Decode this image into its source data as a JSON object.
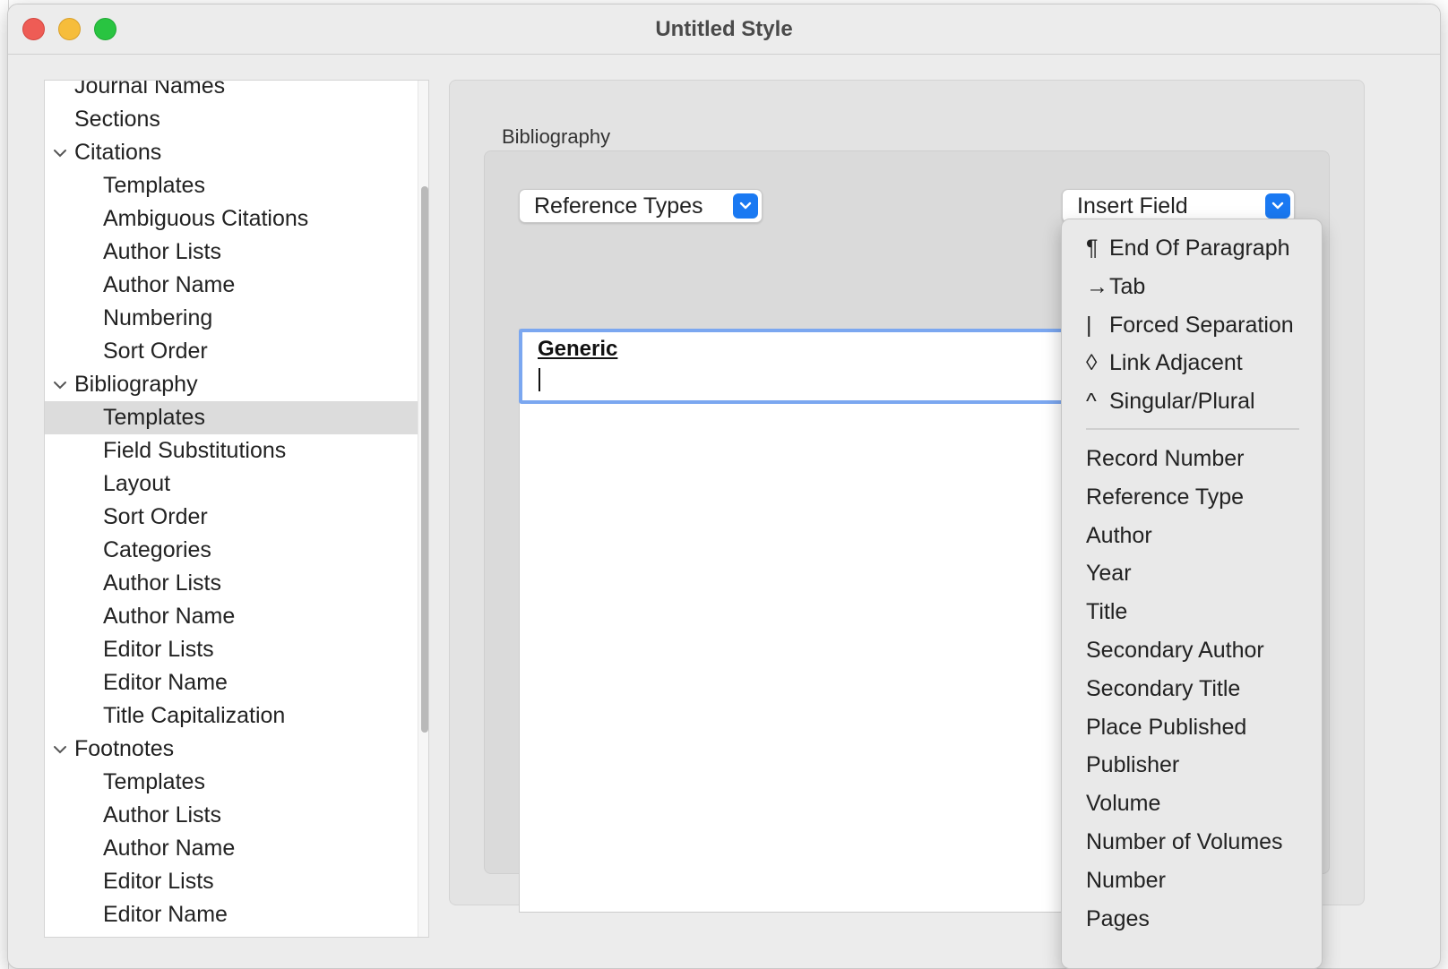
{
  "window": {
    "title": "Untitled Style"
  },
  "sidebar": {
    "items": [
      {
        "label": "Journal Names",
        "level": 0
      },
      {
        "label": "Sections",
        "level": 0
      },
      {
        "label": "Citations",
        "level": 0,
        "expanded": true
      },
      {
        "label": "Templates",
        "level": 1
      },
      {
        "label": "Ambiguous Citations",
        "level": 1
      },
      {
        "label": "Author Lists",
        "level": 1
      },
      {
        "label": "Author Name",
        "level": 1
      },
      {
        "label": "Numbering",
        "level": 1
      },
      {
        "label": "Sort Order",
        "level": 1
      },
      {
        "label": "Bibliography",
        "level": 0,
        "expanded": true
      },
      {
        "label": "Templates",
        "level": 1,
        "selected": true
      },
      {
        "label": "Field Substitutions",
        "level": 1
      },
      {
        "label": "Layout",
        "level": 1
      },
      {
        "label": "Sort Order",
        "level": 1
      },
      {
        "label": "Categories",
        "level": 1
      },
      {
        "label": "Author Lists",
        "level": 1
      },
      {
        "label": "Author Name",
        "level": 1
      },
      {
        "label": "Editor Lists",
        "level": 1
      },
      {
        "label": "Editor Name",
        "level": 1
      },
      {
        "label": "Title Capitalization",
        "level": 1
      },
      {
        "label": "Footnotes",
        "level": 0,
        "expanded": true
      },
      {
        "label": "Templates",
        "level": 1
      },
      {
        "label": "Author Lists",
        "level": 1
      },
      {
        "label": "Author Name",
        "level": 1
      },
      {
        "label": "Editor Lists",
        "level": 1
      },
      {
        "label": "Editor Name",
        "level": 1
      }
    ]
  },
  "main": {
    "group_label": "Bibliography",
    "reference_types_label": "Reference Types",
    "insert_field_label": "Insert Field",
    "editor_heading": "Generic"
  },
  "insert_menu": {
    "special": [
      {
        "symbol": "¶",
        "label": "End Of Paragraph"
      },
      {
        "symbol": "→",
        "label": "Tab"
      },
      {
        "symbol": "|",
        "label": "Forced Separation"
      },
      {
        "symbol": "◊",
        "label": "Link Adjacent"
      },
      {
        "symbol": "^",
        "label": "Singular/Plural"
      }
    ],
    "fields": [
      "Record Number",
      "Reference Type",
      "Author",
      "Year",
      "Title",
      "Secondary Author",
      "Secondary Title",
      "Place Published",
      "Publisher",
      "Volume",
      "Number of Volumes",
      "Number",
      "Pages"
    ]
  },
  "colors": {
    "accent": "#1a79f2",
    "focus_ring": "#7ba7f0",
    "selection": "#dcdcdc"
  }
}
